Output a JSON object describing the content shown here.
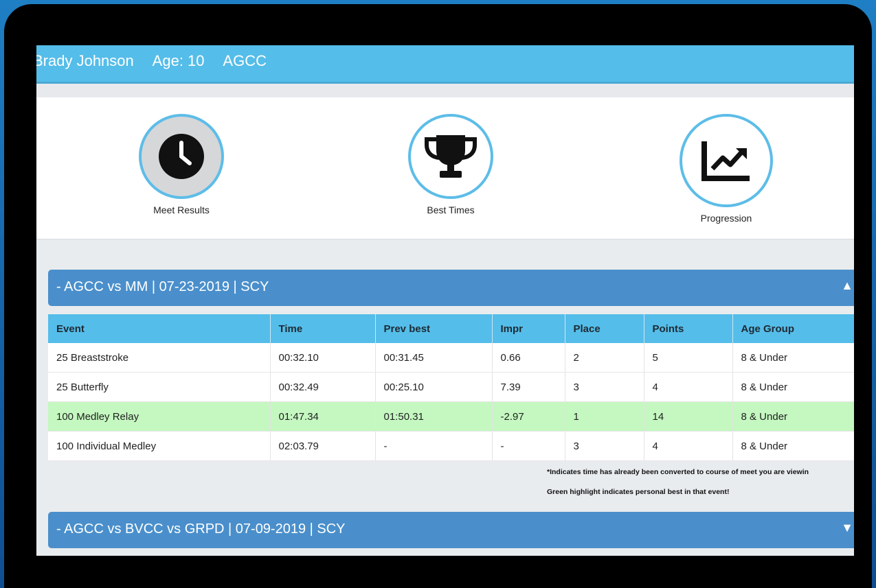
{
  "athlete": {
    "name": "Brady Johnson",
    "age": "Age: 10",
    "team": "AGCC"
  },
  "nav": {
    "meet_results": "Meet Results",
    "best_times": "Best Times",
    "progression": "Progression"
  },
  "meets": [
    {
      "title": "- AGCC vs MM | 07-23-2019 | SCY",
      "arrow": "▲",
      "expanded": true
    },
    {
      "title": "- AGCC vs BVCC vs GRPD | 07-09-2019 | SCY",
      "arrow": "▼",
      "expanded": false
    }
  ],
  "table": {
    "headers": [
      "Event",
      "Time",
      "Prev best",
      "Impr",
      "Place",
      "Points",
      "Age Group"
    ],
    "rows": [
      [
        "25 Breaststroke",
        "00:32.10",
        "00:31.45",
        "0.66",
        "2",
        "5",
        "8 & Under"
      ],
      [
        "25 Butterfly",
        "00:32.49",
        "00:25.10",
        "7.39",
        "3",
        "4",
        "8 & Under"
      ],
      [
        "100 Medley Relay",
        "01:47.34",
        "01:50.31",
        "-2.97",
        "1",
        "14",
        "8 & Under"
      ],
      [
        "100 Individual Medley",
        "02:03.79",
        "-",
        "-",
        "3",
        "4",
        "8 & Under"
      ]
    ],
    "highlight_row": 2,
    "highlight_color": "#c4f8c0"
  },
  "notes": {
    "converted": "*Indicates time has already been converted to course of meet you are viewin",
    "green": "Green highlight indicates personal best in that event!"
  },
  "colors": {
    "topbar": "#55bde9",
    "section_header": "#4a8fcb",
    "circle_border": "#5dbde8"
  }
}
